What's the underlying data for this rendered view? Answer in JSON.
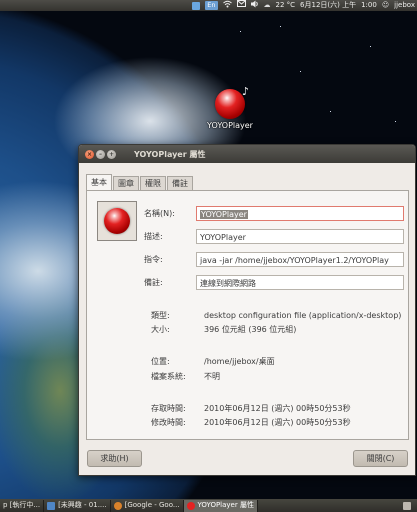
{
  "top_panel": {
    "kb_label": "En",
    "temperature": "22 °C",
    "date": "6月12日(六) 上午",
    "time": "1:00",
    "user": "jjebox"
  },
  "desktop_icon": {
    "label": "YOYOPlayer"
  },
  "dialog": {
    "title": "YOYOPlayer 屬性",
    "tabs": [
      "基本",
      "圖章",
      "權限",
      "備註"
    ],
    "fields": {
      "name_label": "名稱(N):",
      "name_value": "YOYOPlayer",
      "desc_label": "描述:",
      "desc_value": "YOYOPlayer",
      "cmd_label": "指令:",
      "cmd_value": "java -jar /home/jjebox/YOYOPlayer1.2/YOYOPlay",
      "note_label": "備註:",
      "note_value": "連線到網際網路"
    },
    "info": {
      "type_label": "類型:",
      "type_value": "desktop configuration file (application/x-desktop)",
      "size_label": "大小:",
      "size_value": "396 位元組 (396 位元組)",
      "loc_label": "位置:",
      "loc_value": "/home/jjebox/桌面",
      "fs_label": "檔案系統:",
      "fs_value": "不明",
      "access_label": "存取時間:",
      "access_value": "2010年06月12日 (週六) 00時50分53秒",
      "modify_label": "修改時間:",
      "modify_value": "2010年06月12日 (週六) 00時50分53秒"
    },
    "help_button": "求助(H)",
    "close_button": "關閉(C)"
  },
  "taskbar": {
    "items": [
      "p [執行中...",
      "[未興趣 - 01....",
      "[Google - Goo...",
      "YOYOPlayer 屬性"
    ]
  },
  "colors": {
    "titlebar": "#3c3b37",
    "dialog_bg": "#efebe7",
    "close_button": "#e2522a",
    "selection": "#8a8680",
    "red_icon": "#e32222"
  }
}
